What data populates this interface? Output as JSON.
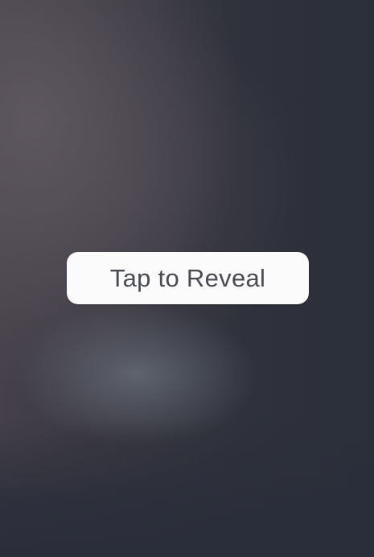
{
  "overlay": {
    "reveal_button_label": "Tap to Reveal"
  },
  "colors": {
    "background": "#2b2f3a",
    "button_background": "#fbfbfc",
    "button_text": "#4a4c53"
  }
}
